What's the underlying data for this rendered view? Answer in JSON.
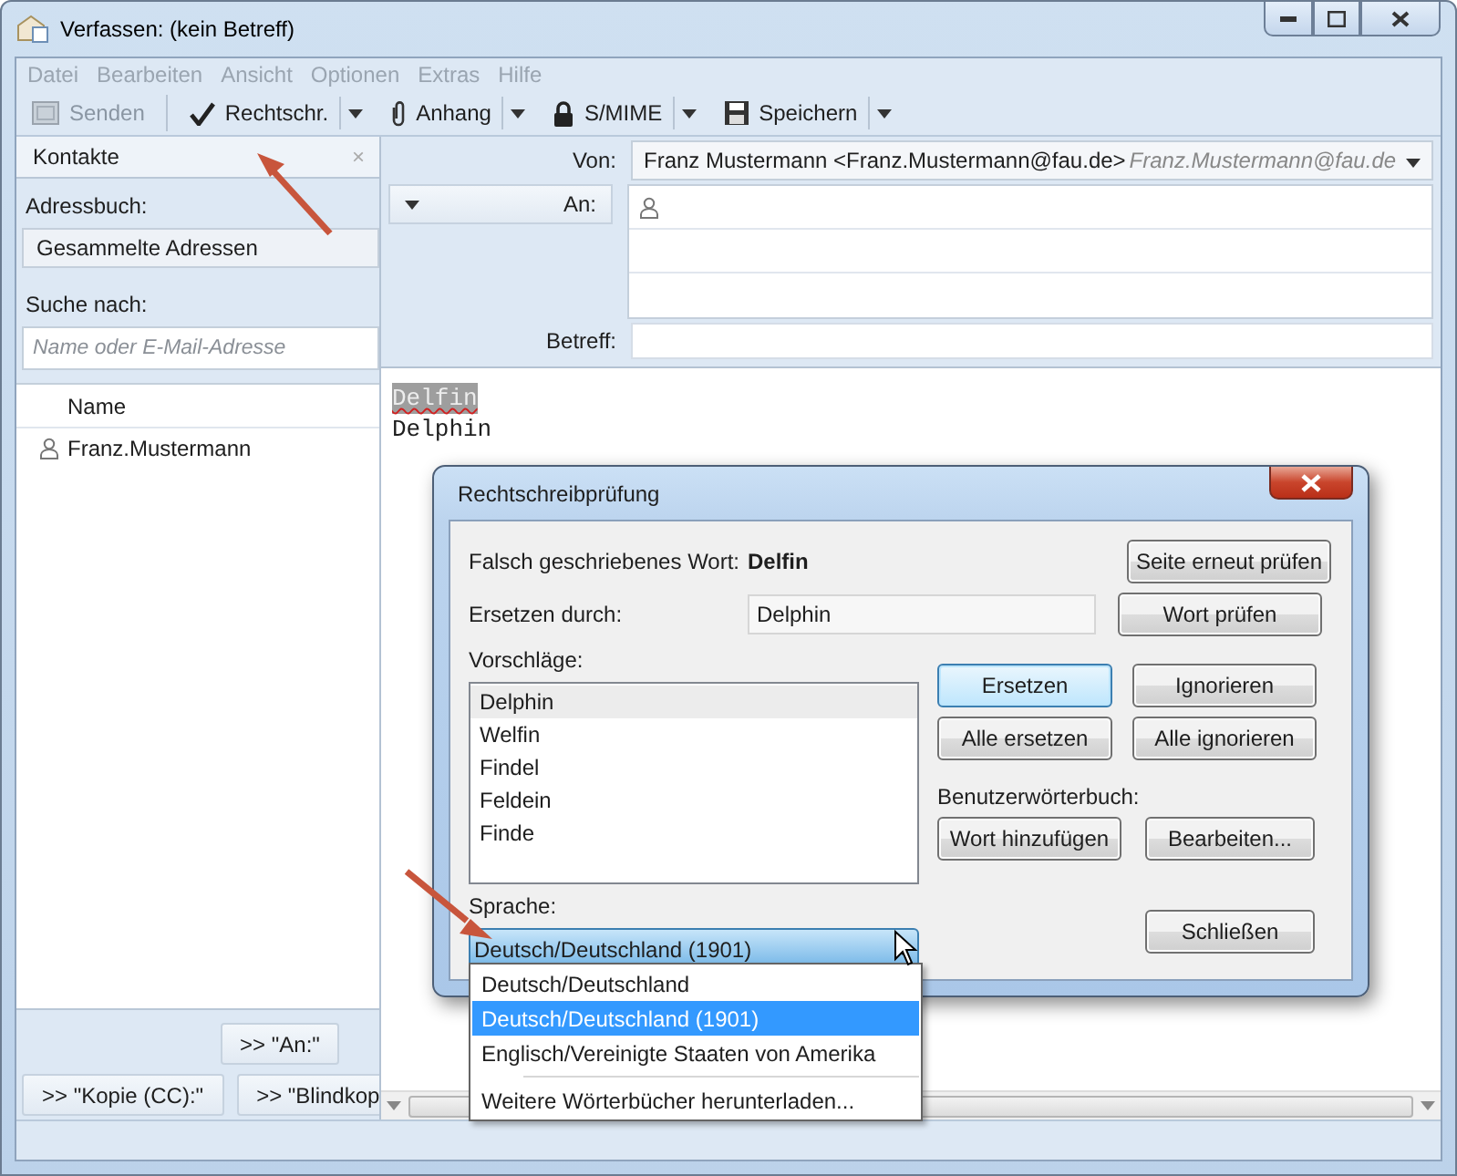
{
  "window": {
    "title": "Verfassen: (kein Betreff)"
  },
  "menu": [
    "Datei",
    "Bearbeiten",
    "Ansicht",
    "Optionen",
    "Extras",
    "Hilfe"
  ],
  "toolbar": [
    {
      "label": "Senden",
      "kind": "send",
      "disabled": true,
      "dropdown": false
    },
    {
      "label": "Rechtschr.",
      "kind": "spelling",
      "disabled": false,
      "dropdown": true
    },
    {
      "label": "Anhang",
      "kind": "attachment",
      "disabled": false,
      "dropdown": true
    },
    {
      "label": "S/MIME",
      "kind": "security",
      "disabled": false,
      "dropdown": true
    },
    {
      "label": "Speichern",
      "kind": "save",
      "disabled": false,
      "dropdown": true
    }
  ],
  "sidebar": {
    "title": "Kontakte",
    "close": "×",
    "address_book_label": "Adressbuch:",
    "address_book": "Gesammelte Adressen",
    "search_label": "Suche nach:",
    "search_placeholder": "Name oder E-Mail-Adresse",
    "column": "Name",
    "contacts": [
      "Franz.Mustermann"
    ],
    "to_button": ">> \"An:\"",
    "cc_button": ">> \"Kopie (CC):\"",
    "bcc_button": ">> \"Blindkop"
  },
  "header": {
    "from_label": "Von:",
    "from": "Franz Mustermann <Franz.Mustermann@fau.de>",
    "from_identity": "Franz.Mustermann@fau.de",
    "to_label": "An:",
    "subject_label": "Betreff:"
  },
  "body": {
    "lines": [
      {
        "text": "Delfin",
        "misspelled": true
      },
      {
        "text": "Delphin",
        "misspelled": false
      }
    ]
  },
  "dialog": {
    "title": "Rechtschreibprüfung",
    "misspelled_label": "Falsch geschriebenes Wort:",
    "misspelled_word": "Delfin",
    "recheck_button": "Seite erneut prüfen",
    "replace_label": "Ersetzen durch:",
    "replace_value": "Delphin",
    "check_word_button": "Wort prüfen",
    "suggestions_label": "Vorschläge:",
    "suggestions": [
      {
        "text": "Delphin",
        "selected": true
      },
      {
        "text": "Welfin",
        "selected": false
      },
      {
        "text": "Findel",
        "selected": false
      },
      {
        "text": "Feldein",
        "selected": false
      },
      {
        "text": "Finde",
        "selected": false
      }
    ],
    "replace_button": "Ersetzen",
    "ignore_button": "Ignorieren",
    "replace_all_button": "Alle ersetzen",
    "ignore_all_button": "Alle ignorieren",
    "dictionary_label": "Benutzerwörterbuch:",
    "add_word_button": "Wort hinzufügen",
    "edit_button": "Bearbeiten...",
    "language_label": "Sprache:",
    "language": "Deutsch/Deutschland (1901)",
    "close_button": "Schließen"
  },
  "language_menu": {
    "options": [
      {
        "text": "Deutsch/Deutschland",
        "selected": false
      },
      {
        "text": "Deutsch/Deutschland (1901)",
        "selected": true
      },
      {
        "text": "Englisch/Vereinigte Staaten von Amerika",
        "selected": false
      }
    ],
    "more": "Weitere Wörterbücher herunterladen..."
  }
}
